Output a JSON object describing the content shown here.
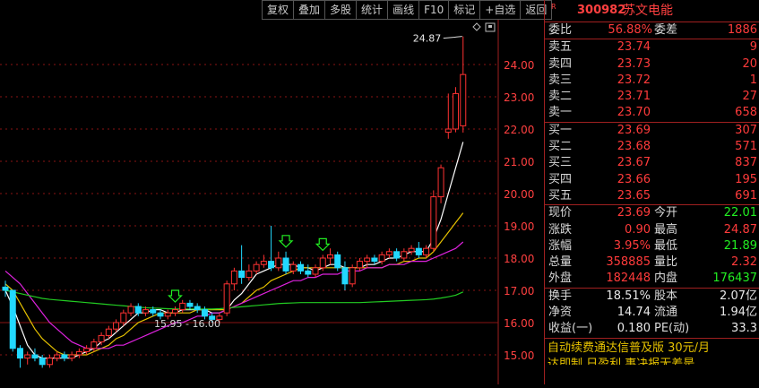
{
  "toolbar": [
    "复权",
    "叠加",
    "多股",
    "统计",
    "画线",
    "F10",
    "标记",
    "+自选",
    "返回"
  ],
  "chart": {
    "y_ticks": [
      "24.00",
      "23.00",
      "22.00",
      "21.00",
      "20.00",
      "19.00",
      "18.00",
      "17.00",
      "16.00",
      "15.00"
    ],
    "high_label": "24.87",
    "range_label": "15.95 - 16.00"
  },
  "quote": {
    "code": "300982",
    "name": "苏文电能",
    "r_badge": "R",
    "ratio_label": "委比",
    "ratio_value": "56.88%",
    "diff_label": "委差",
    "diff_value": "1886",
    "asks": [
      {
        "label": "卖五",
        "price": "23.74",
        "vol": "9"
      },
      {
        "label": "卖四",
        "price": "23.73",
        "vol": "20"
      },
      {
        "label": "卖三",
        "price": "23.72",
        "vol": "1"
      },
      {
        "label": "卖二",
        "price": "23.71",
        "vol": "27"
      },
      {
        "label": "卖一",
        "price": "23.70",
        "vol": "658"
      }
    ],
    "bids": [
      {
        "label": "买一",
        "price": "23.69",
        "vol": "307"
      },
      {
        "label": "买二",
        "price": "23.68",
        "vol": "571"
      },
      {
        "label": "买三",
        "price": "23.67",
        "vol": "837"
      },
      {
        "label": "买四",
        "price": "23.66",
        "vol": "195"
      },
      {
        "label": "买五",
        "price": "23.65",
        "vol": "691"
      }
    ],
    "stats1": [
      {
        "l1": "现价",
        "v1": "23.69",
        "l2": "今开",
        "v2": "22.01"
      },
      {
        "l1": "涨跌",
        "v1": "0.90",
        "l2": "最高",
        "v2": "24.87"
      },
      {
        "l1": "涨幅",
        "v1": "3.95%",
        "l2": "最低",
        "v2": "21.89"
      },
      {
        "l1": "总量",
        "v1": "358885",
        "l2": "量比",
        "v2": "2.32"
      },
      {
        "l1": "外盘",
        "v1": "182448",
        "l2": "内盘",
        "v2": "176437"
      }
    ],
    "stats2": [
      {
        "l1": "换手",
        "v1": "18.51%",
        "l2": "股本",
        "v2": "2.07亿"
      },
      {
        "l1": "净资",
        "v1": "14.74",
        "l2": "流通",
        "v2": "1.94亿"
      },
      {
        "l1": "收益(一)",
        "v1": "0.180",
        "l2": "PE(动)",
        "v2": "33.3"
      }
    ],
    "footer1": "自动续费通达信普及版  30元/月",
    "footer2": "达即制 日盈利 事决报无差是"
  },
  "chart_data": {
    "type": "candlestick",
    "ylim": [
      14.6,
      25.0
    ],
    "candles": [
      [
        17.1,
        17.3,
        16.8,
        17.0
      ],
      [
        17.0,
        17.0,
        15.1,
        15.2
      ],
      [
        15.2,
        15.3,
        14.6,
        14.9
      ],
      [
        14.9,
        15.1,
        14.7,
        15.0
      ],
      [
        15.0,
        15.2,
        14.8,
        14.9
      ],
      [
        14.9,
        15.0,
        14.6,
        14.7
      ],
      [
        14.7,
        15.0,
        14.6,
        14.9
      ],
      [
        14.9,
        15.1,
        14.8,
        15.0
      ],
      [
        15.0,
        15.1,
        14.8,
        14.9
      ],
      [
        14.9,
        15.1,
        14.8,
        15.0
      ],
      [
        15.0,
        15.2,
        14.9,
        15.1
      ],
      [
        15.1,
        15.3,
        15.0,
        15.2
      ],
      [
        15.2,
        15.5,
        15.1,
        15.4
      ],
      [
        15.4,
        15.7,
        15.3,
        15.6
      ],
      [
        15.6,
        15.9,
        15.5,
        15.8
      ],
      [
        15.8,
        16.1,
        15.7,
        16.0
      ],
      [
        16.0,
        16.4,
        15.9,
        16.3
      ],
      [
        16.3,
        16.6,
        16.2,
        16.5
      ],
      [
        16.5,
        16.6,
        16.2,
        16.3
      ],
      [
        16.3,
        16.5,
        16.2,
        16.4
      ],
      [
        16.4,
        16.5,
        16.2,
        16.3
      ],
      [
        16.3,
        16.4,
        16.1,
        16.2
      ],
      [
        16.2,
        16.4,
        16.1,
        16.3
      ],
      [
        16.3,
        16.5,
        16.2,
        16.4
      ],
      [
        16.4,
        16.7,
        16.3,
        16.6
      ],
      [
        16.6,
        16.7,
        16.4,
        16.5
      ],
      [
        16.5,
        16.6,
        16.3,
        16.4
      ],
      [
        16.4,
        16.5,
        16.1,
        16.2
      ],
      [
        16.2,
        16.3,
        16.0,
        16.1
      ],
      [
        16.1,
        16.3,
        16.0,
        16.2
      ],
      [
        16.3,
        17.3,
        16.2,
        17.2
      ],
      [
        17.2,
        17.7,
        17.0,
        17.6
      ],
      [
        17.6,
        18.4,
        17.2,
        17.4
      ],
      [
        17.4,
        17.8,
        17.3,
        17.6
      ],
      [
        17.6,
        17.9,
        17.5,
        17.8
      ],
      [
        17.8,
        18.1,
        17.7,
        17.9
      ],
      [
        17.9,
        19.0,
        17.6,
        17.7
      ],
      [
        17.7,
        18.2,
        17.6,
        18.0
      ],
      [
        18.0,
        18.2,
        17.5,
        17.6
      ],
      [
        17.6,
        17.9,
        17.5,
        17.8
      ],
      [
        17.8,
        17.9,
        17.5,
        17.6
      ],
      [
        17.6,
        17.8,
        17.4,
        17.5
      ],
      [
        17.5,
        17.8,
        17.4,
        17.7
      ],
      [
        17.7,
        18.1,
        17.6,
        18.0
      ],
      [
        18.0,
        18.3,
        17.8,
        18.1
      ],
      [
        18.1,
        18.2,
        17.6,
        17.7
      ],
      [
        17.7,
        17.9,
        17.0,
        17.2
      ],
      [
        17.2,
        17.8,
        17.1,
        17.7
      ],
      [
        17.7,
        18.0,
        17.6,
        17.9
      ],
      [
        17.9,
        18.1,
        17.7,
        18.0
      ],
      [
        18.0,
        18.1,
        17.8,
        17.9
      ],
      [
        17.9,
        18.2,
        17.8,
        18.1
      ],
      [
        18.1,
        18.3,
        18.0,
        18.2
      ],
      [
        18.2,
        18.3,
        17.9,
        18.0
      ],
      [
        18.0,
        18.3,
        17.9,
        18.2
      ],
      [
        18.2,
        18.4,
        18.1,
        18.3
      ],
      [
        18.3,
        18.5,
        18.0,
        18.1
      ],
      [
        18.1,
        18.4,
        18.0,
        18.3
      ],
      [
        18.3,
        20.1,
        18.2,
        19.9
      ],
      [
        19.9,
        20.9,
        19.7,
        20.8
      ],
      [
        21.9,
        23.1,
        21.7,
        22.0
      ],
      [
        22.0,
        23.3,
        21.9,
        23.1
      ],
      [
        22.1,
        24.87,
        21.89,
        23.69
      ]
    ],
    "ma_series": [
      {
        "color": "#ffffff",
        "values": [
          17.0,
          16.5,
          15.9,
          15.3,
          15.0,
          14.9,
          14.9,
          14.9,
          14.9,
          14.9,
          15.0,
          15.1,
          15.2,
          15.4,
          15.5,
          15.7,
          15.9,
          16.1,
          16.3,
          16.3,
          16.4,
          16.4,
          16.3,
          16.3,
          16.4,
          16.4,
          16.4,
          16.4,
          16.3,
          16.3,
          16.4,
          16.7,
          16.9,
          17.2,
          17.5,
          17.6,
          17.7,
          17.8,
          17.8,
          17.8,
          17.7,
          17.7,
          17.6,
          17.7,
          17.8,
          17.8,
          17.7,
          17.7,
          17.7,
          17.8,
          17.8,
          17.9,
          18.0,
          18.0,
          18.1,
          18.2,
          18.2,
          18.2,
          18.6,
          19.2,
          20.0,
          20.8,
          21.6
        ]
      },
      {
        "color": "#e6c200",
        "values": [
          17.2,
          17.0,
          16.6,
          16.2,
          15.8,
          15.5,
          15.3,
          15.1,
          15.0,
          15.0,
          15.0,
          15.0,
          15.1,
          15.2,
          15.3,
          15.5,
          15.6,
          15.8,
          16.0,
          16.1,
          16.2,
          16.3,
          16.3,
          16.3,
          16.3,
          16.3,
          16.4,
          16.4,
          16.4,
          16.4,
          16.4,
          16.5,
          16.6,
          16.8,
          17.0,
          17.1,
          17.3,
          17.4,
          17.5,
          17.6,
          17.7,
          17.7,
          17.7,
          17.7,
          17.7,
          17.7,
          17.7,
          17.7,
          17.7,
          17.7,
          17.7,
          17.7,
          17.8,
          17.8,
          17.9,
          17.9,
          18.0,
          18.0,
          18.2,
          18.5,
          18.8,
          19.1,
          19.4
        ]
      },
      {
        "color": "#dd22dd",
        "values": [
          17.6,
          17.4,
          17.2,
          16.9,
          16.6,
          16.3,
          16.0,
          15.8,
          15.6,
          15.4,
          15.3,
          15.2,
          15.2,
          15.2,
          15.2,
          15.3,
          15.3,
          15.4,
          15.5,
          15.6,
          15.7,
          15.8,
          15.9,
          16.0,
          16.0,
          16.1,
          16.2,
          16.2,
          16.3,
          16.3,
          16.4,
          16.5,
          16.6,
          16.7,
          16.8,
          16.9,
          17.0,
          17.1,
          17.2,
          17.3,
          17.3,
          17.4,
          17.4,
          17.5,
          17.5,
          17.5,
          17.6,
          17.6,
          17.6,
          17.7,
          17.7,
          17.7,
          17.8,
          17.8,
          17.8,
          17.9,
          17.9,
          17.9,
          18.0,
          18.1,
          18.2,
          18.3,
          18.5
        ]
      },
      {
        "color": "#22cc22",
        "values": [
          17.0,
          16.95,
          16.9,
          16.85,
          16.8,
          16.75,
          16.72,
          16.7,
          16.68,
          16.66,
          16.64,
          16.62,
          16.6,
          16.58,
          16.56,
          16.54,
          16.52,
          16.5,
          16.48,
          16.46,
          16.45,
          16.44,
          16.43,
          16.42,
          16.42,
          16.42,
          16.42,
          16.42,
          16.42,
          16.43,
          16.45,
          16.47,
          16.49,
          16.51,
          16.53,
          16.55,
          16.57,
          16.59,
          16.6,
          16.61,
          16.62,
          16.62,
          16.62,
          16.62,
          16.62,
          16.62,
          16.62,
          16.62,
          16.62,
          16.63,
          16.64,
          16.65,
          16.66,
          16.67,
          16.68,
          16.69,
          16.7,
          16.71,
          16.73,
          16.76,
          16.8,
          16.85,
          16.95
        ]
      }
    ],
    "arrows_at": [
      23,
      38,
      43
    ]
  }
}
